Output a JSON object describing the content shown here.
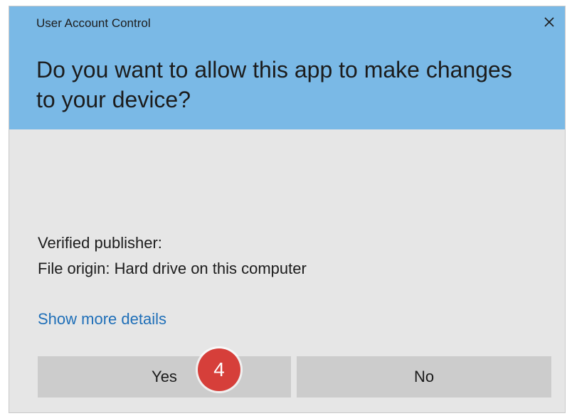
{
  "dialog": {
    "window_title": "User Account Control",
    "close_icon": "close-icon",
    "question": "Do you want to allow this app to make changes to your device?",
    "verified_publisher": "Verified publisher:",
    "file_origin": "File origin: Hard drive on this computer",
    "show_more_details": "Show more details",
    "yes_label": "Yes",
    "no_label": "No"
  },
  "annotation": {
    "step_number": "4",
    "badge_color": "#d63f3a"
  },
  "colors": {
    "header_bg": "#7ab9e6",
    "body_bg": "#e6e6e6",
    "button_bg": "#cccccc",
    "link": "#1f6fb8"
  }
}
